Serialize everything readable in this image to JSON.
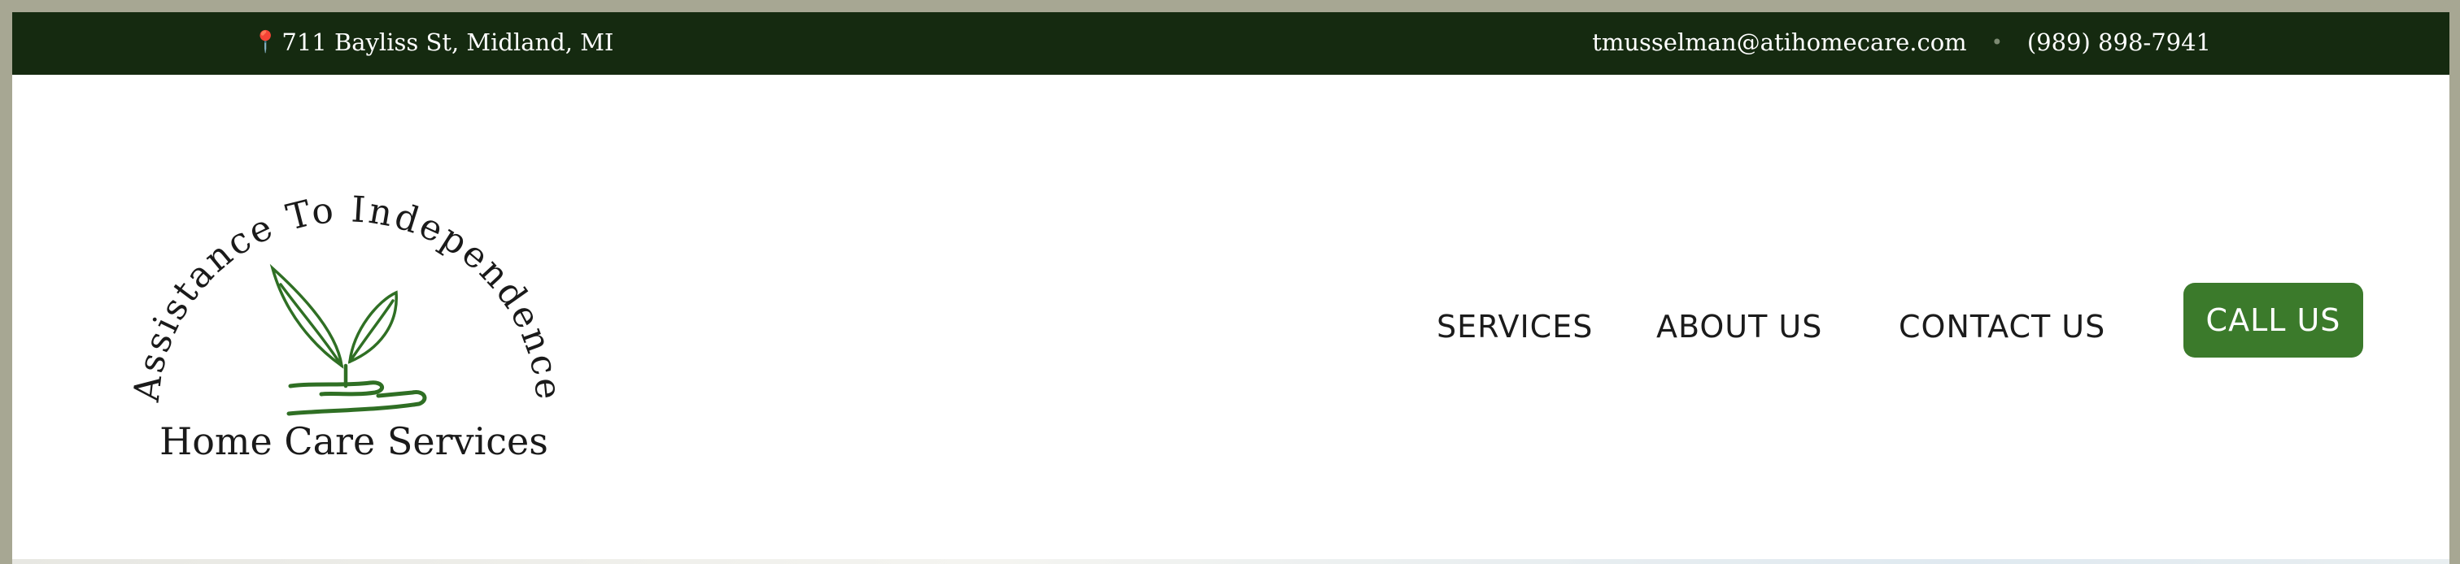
{
  "topbar": {
    "address": "711 Bayliss St, Midland, MI",
    "address_icon": "map-pin-icon",
    "email": "tmusselman@atihomecare.com",
    "separator": "•",
    "phone": "(989) 898-7941"
  },
  "logo": {
    "arc_text": "Assistance To Independence",
    "subtitle": "Home Care Services",
    "icon": "sprout-in-hand-icon",
    "accent_color": "#3b7a2b"
  },
  "nav": {
    "items": [
      {
        "label": "SERVICES"
      },
      {
        "label": "ABOUT US"
      },
      {
        "label": "CONTACT US"
      }
    ],
    "cta_label": "CALL US"
  },
  "colors": {
    "topbar_bg": "#152a10",
    "cta_bg": "#3b7a2b",
    "frame_bg": "#a7a793"
  }
}
